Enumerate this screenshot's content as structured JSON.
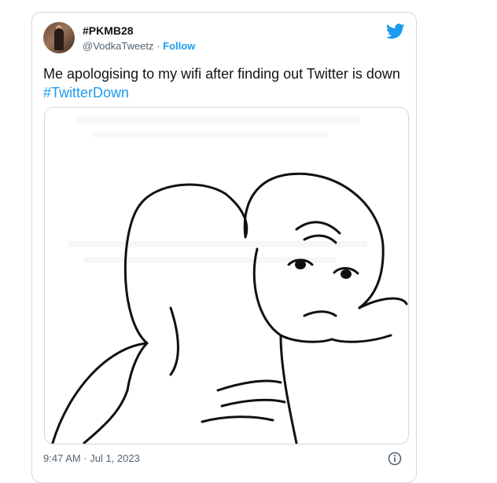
{
  "tweet": {
    "display_name": "#PKMB28",
    "handle": "@VodkaTweetz",
    "separator": "·",
    "follow_label": "Follow",
    "text_main": "Me apologising to my wifi after finding out Twitter is down",
    "hashtag": "#TwitterDown",
    "timestamp": "9:47 AM · Jul 1, 2023",
    "media_description_icon": "meme-hug-image"
  },
  "icons": {
    "brand": "twitter-bird-icon",
    "info": "info-icon"
  },
  "colors": {
    "accent": "#1d9bf0",
    "text_primary": "#0f1419",
    "text_secondary": "#536471",
    "border": "#cfd9de"
  }
}
